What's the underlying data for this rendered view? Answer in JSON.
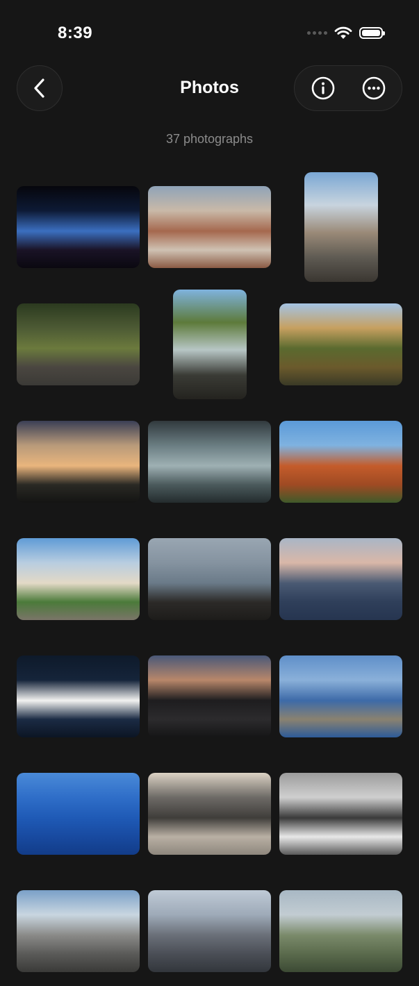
{
  "status": {
    "time": "8:39"
  },
  "header": {
    "title": "Photos",
    "subtitle": "37 photographs"
  },
  "icons": {
    "back": "chevron-left-icon",
    "info": "info-icon",
    "more": "ellipsis-icon",
    "wifi": "wifi-icon",
    "battery": "battery-icon",
    "signal": "signal-dots-icon"
  },
  "photos": [
    {
      "subject": "horizon-at-dusk",
      "orientation": "landscape",
      "colors": [
        "#06060c",
        "#0d1a35",
        "#3b6fc0",
        "#1a1326",
        "#0a0810"
      ]
    },
    {
      "subject": "city-rooftops",
      "orientation": "landscape",
      "colors": [
        "#8fa3b8",
        "#c9b9a8",
        "#a5684e",
        "#cfc2b3",
        "#8a5a44"
      ]
    },
    {
      "subject": "narrow-street",
      "orientation": "portrait",
      "colors": [
        "#7aa7d4",
        "#c8d4de",
        "#9a8a78",
        "#5e5a52",
        "#3a3631"
      ]
    },
    {
      "subject": "peacock",
      "orientation": "landscape",
      "colors": [
        "#2b3a1f",
        "#4d5a34",
        "#6b7a3d",
        "#4a4640",
        "#3b3a36"
      ]
    },
    {
      "subject": "restaurant-terrace",
      "orientation": "portrait",
      "colors": [
        "#7fb3de",
        "#5d7a3a",
        "#b7c6c5",
        "#3a3b35",
        "#24231f"
      ]
    },
    {
      "subject": "pine-trees",
      "orientation": "landscape",
      "colors": [
        "#a4c4e4",
        "#c7a060",
        "#5a6a2f",
        "#6b5a2c",
        "#3a3a26"
      ]
    },
    {
      "subject": "palm-sunset",
      "orientation": "landscape",
      "colors": [
        "#3a3f55",
        "#b89a7a",
        "#e9b57d",
        "#2a2924",
        "#141413"
      ]
    },
    {
      "subject": "fish-market",
      "orientation": "landscape",
      "colors": [
        "#31393d",
        "#6a7d82",
        "#9eb0b3",
        "#4b5a5c",
        "#242c2e"
      ]
    },
    {
      "subject": "coastal-cliffs",
      "orientation": "landscape",
      "colors": [
        "#5b9ad8",
        "#7fb2e0",
        "#c45c2b",
        "#9f4a23",
        "#3f5a2a"
      ]
    },
    {
      "subject": "resort-building",
      "orientation": "landscape",
      "colors": [
        "#5f9bd6",
        "#b8cde0",
        "#e3d9c6",
        "#4b7a3a",
        "#7a7568"
      ]
    },
    {
      "subject": "lakeside-people",
      "orientation": "landscape",
      "colors": [
        "#99a6b2",
        "#8593a0",
        "#6a7a88",
        "#2c2a28",
        "#1d1c1a"
      ]
    },
    {
      "subject": "harbor-dusk",
      "orientation": "landscape",
      "colors": [
        "#a9b6c6",
        "#d9b7a8",
        "#4a5a73",
        "#2f3f5a",
        "#263550"
      ]
    },
    {
      "subject": "white-swan",
      "orientation": "landscape",
      "colors": [
        "#0e1a2a",
        "#15243a",
        "#f2f2f0",
        "#1b2b44",
        "#0c1524"
      ]
    },
    {
      "subject": "modern-building-sunset",
      "orientation": "landscape",
      "colors": [
        "#4a5878",
        "#b8876a",
        "#1e1d1f",
        "#2c2b2d",
        "#151516"
      ]
    },
    {
      "subject": "lake-sculpture",
      "orientation": "landscape",
      "colors": [
        "#5f8fc9",
        "#8ab0d9",
        "#3d6aa8",
        "#8a8270",
        "#2d5b98"
      ]
    },
    {
      "subject": "open-sea",
      "orientation": "landscape",
      "colors": [
        "#4a8ad8",
        "#2f6ec8",
        "#1f5ab6",
        "#184aa0",
        "#123c88"
      ]
    },
    {
      "subject": "campus-architecture",
      "orientation": "landscape",
      "colors": [
        "#dcd2c4",
        "#6d6a66",
        "#3f3d3a",
        "#b9b0a4",
        "#8e877d"
      ]
    },
    {
      "subject": "bw-pattern-structure",
      "orientation": "landscape",
      "colors": [
        "#9c9c9c",
        "#cfcfcf",
        "#3a3a3a",
        "#e8e8e8",
        "#5a5a5a"
      ]
    },
    {
      "subject": "building-rooftop",
      "orientation": "landscape",
      "colors": [
        "#7aa0c8",
        "#c9d6e0",
        "#8a8a88",
        "#5a5a58",
        "#3a3a38"
      ]
    },
    {
      "subject": "church-spire",
      "orientation": "landscape",
      "colors": [
        "#bfcad6",
        "#9eaab8",
        "#6a6f78",
        "#4a4e56",
        "#32363c"
      ]
    },
    {
      "subject": "hillside",
      "orientation": "landscape",
      "colors": [
        "#a8b8c4",
        "#c2ccd2",
        "#7a8a6a",
        "#5a6a4c",
        "#3c4a34"
      ]
    }
  ]
}
